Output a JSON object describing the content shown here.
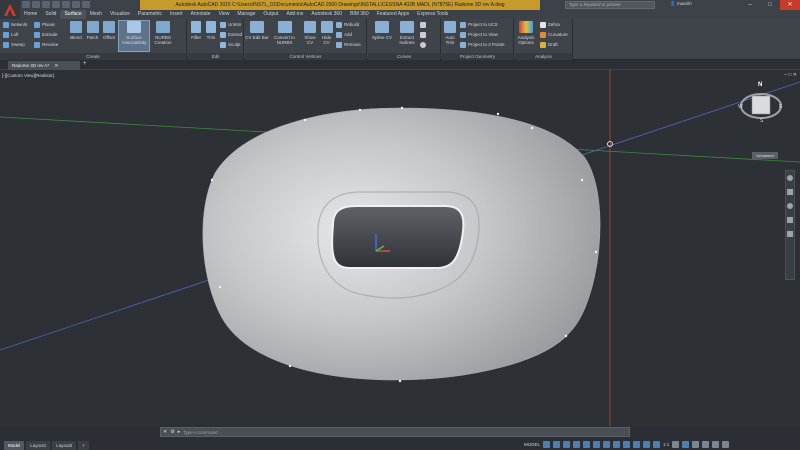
{
  "title_bar": {
    "title": "Autodesk AutoCAD 2015   C:\\Users\\INSTL_01\\Documents\\AutoCAD 2000 Drawings\\INSTALL\\CESSNA 402B MADL (N7875E) Radome 3D rev A.dwg",
    "help_placeholder": "Type a keyword or phrase",
    "user": "maarith",
    "window_controls": [
      "–",
      "□",
      "✕"
    ]
  },
  "ribbon_tabs": [
    "Home",
    "Solid",
    "Surface",
    "Mesh",
    "Visualize",
    "Parametric",
    "Insert",
    "Annotate",
    "View",
    "Manage",
    "Output",
    "Add-ins",
    "Autodesk 360",
    "BIM 360",
    "Featured Apps",
    "Express Tools"
  ],
  "active_tab": "Surface",
  "panels": {
    "create": {
      "title": "Create",
      "small_col1": [
        "Network",
        "Loft",
        "Sweep"
      ],
      "small_col2": [
        "Planar",
        "Extrude",
        "Revolve"
      ],
      "big": [
        "Blend",
        "Patch",
        "Offset",
        "Surface Associativity",
        "NURBS Creation"
      ]
    },
    "edit": {
      "title": "Edit",
      "big": [
        "Fillet",
        "Trim"
      ],
      "small": [
        "Untrim",
        "Extend",
        "Sculpt"
      ]
    },
    "control_vertices": {
      "title": "Control Vertices",
      "big": [
        "CV Edit Bar",
        "Convert to NURBS",
        "Show CV",
        "Hide CV"
      ],
      "small": [
        "Rebuild",
        "Add",
        "Remove"
      ]
    },
    "curves": {
      "title": "Curves",
      "big": [
        "Spline CV",
        "Extract Isolines"
      ]
    },
    "project_geometry": {
      "title": "Project Geometry",
      "big": [
        "Auto Trim"
      ],
      "small": [
        "Project to UCS",
        "Project to View",
        "Project to 2 Points"
      ]
    },
    "analysis": {
      "title": "Analysis",
      "big": [
        "Analysis Options"
      ],
      "small": [
        "Zebra",
        "Curvature",
        "Draft"
      ]
    }
  },
  "document": {
    "tab": "Radome 3D rev A*",
    "viewport_label": "[-][Custom View][Realistic]",
    "viewport_controls": "– □ ✕"
  },
  "viewcube": {
    "top": "N",
    "side": "S",
    "left": "W",
    "right": "E",
    "label": "Unnamed"
  },
  "command_line": {
    "placeholder": "Type a command"
  },
  "layout_tabs": [
    "Model",
    "Layout1",
    "Layout2"
  ],
  "status_bar": {
    "model": "MODEL",
    "scale": "1:1"
  },
  "colors": {
    "accent": "#c79a2d",
    "ribbon": "#3f444b",
    "viewport": "#2d3136",
    "x_axis": "#e24c3a",
    "y_axis": "#4cc24a",
    "z_axis": "#4a6ee0",
    "surface": "#c9cbcd"
  }
}
